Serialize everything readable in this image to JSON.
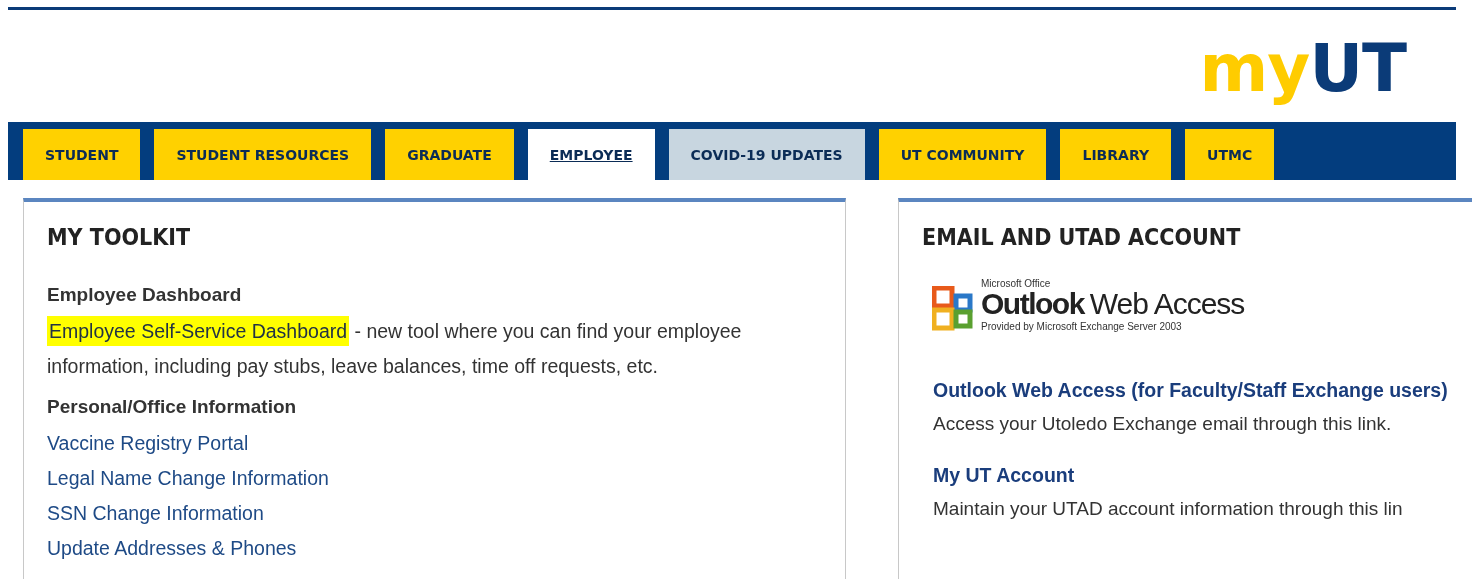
{
  "logo": {
    "part_1": "my",
    "part_2": "UT"
  },
  "tabs": [
    {
      "label": "STUDENT",
      "kind": "normal",
      "selected": false
    },
    {
      "label": "STUDENT RESOURCES",
      "kind": "normal",
      "selected": false
    },
    {
      "label": "GRADUATE",
      "kind": "normal",
      "selected": false
    },
    {
      "label": "EMPLOYEE",
      "kind": "normal",
      "selected": true
    },
    {
      "label": "COVID-19 UPDATES",
      "kind": "alert",
      "selected": false
    },
    {
      "label": "UT COMMUNITY",
      "kind": "normal",
      "selected": false
    },
    {
      "label": "LIBRARY",
      "kind": "normal",
      "selected": false
    },
    {
      "label": "UTMC",
      "kind": "normal",
      "selected": false
    }
  ],
  "toolkit": {
    "title": "MY TOOLKIT",
    "sections": [
      {
        "heading": "Employee Dashboard",
        "items": [
          {
            "link": "Employee Self-Service Dashboard",
            "highlighted": true,
            "description": "- new tool where you can find your employee information, including pay stubs, leave balances, time off requests, etc."
          }
        ]
      },
      {
        "heading": "Personal/Office Information",
        "items": [
          {
            "link": "Vaccine Registry Portal",
            "highlighted": false
          },
          {
            "link": "Legal Name Change Information",
            "highlighted": false
          },
          {
            "link": "SSN Change Information",
            "highlighted": false
          },
          {
            "link": "Update Addresses & Phones",
            "highlighted": false
          }
        ]
      }
    ]
  },
  "email": {
    "title": "EMAIL AND UTAD ACCOUNT",
    "banner": {
      "brand": "Microsoft Office",
      "product_1": "Outlook",
      "product_2": "Web Access",
      "tagline": "Provided by Microsoft Exchange Server 2003"
    },
    "items": [
      {
        "link": "Outlook Web Access (for Faculty/Staff Exchange users)",
        "description": "Access your Utoledo Exchange email through this link."
      },
      {
        "link": "My UT Account",
        "description": "Maintain your UTAD account information through this lin"
      }
    ]
  }
}
